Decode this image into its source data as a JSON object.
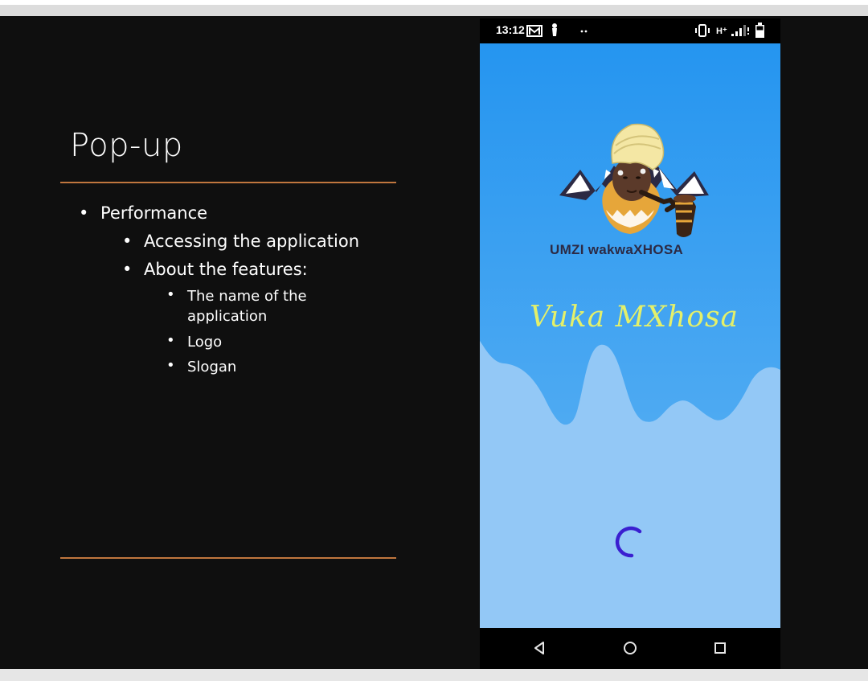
{
  "slide": {
    "title": "Pop-up",
    "bullets": [
      {
        "level": 1,
        "text": "Performance"
      },
      {
        "level": 2,
        "text": "Accessing the application"
      },
      {
        "level": 2,
        "text": "About the features:"
      },
      {
        "level": 3,
        "text": "The name of the application"
      },
      {
        "level": 3,
        "text": "Logo"
      },
      {
        "level": 3,
        "text": "Slogan"
      }
    ],
    "bullet_char": "•",
    "accent_color": "#c0763e"
  },
  "phone": {
    "status_bar": {
      "time": "13:12",
      "network_label": "H⁺",
      "icons": [
        "gmail-icon",
        "notification-icon",
        "more-dots-icon",
        "vibrate-icon",
        "signal-icon",
        "battery-icon"
      ]
    },
    "splash": {
      "logo_text": "UMZI wakwaXHOSA",
      "slogan": "Vuka MXhosa",
      "background_top": "#2196f3",
      "background_bottom": "#93c8f6",
      "spinner_color": "#3a1fd0"
    },
    "nav_bar": {
      "icons": [
        "back-icon",
        "home-icon",
        "recents-icon"
      ]
    }
  }
}
